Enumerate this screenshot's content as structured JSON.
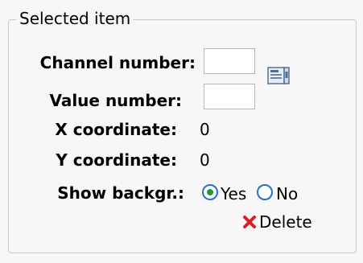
{
  "panel": {
    "legend": "Selected item"
  },
  "form": {
    "channel_label": "Channel number:",
    "channel_value": "",
    "value_label": "Value number:",
    "value_value": "",
    "x_label": "X coordinate:",
    "x_value": "0",
    "y_label": "Y coordinate:",
    "y_value": "0",
    "background_label": "Show backgr.:",
    "background_options": [
      "Yes",
      "No"
    ],
    "background_selected": "Yes"
  },
  "actions": {
    "delete_label": "Delete"
  },
  "icons": {
    "picker": "channel-picker-icon",
    "delete": "delete-x-icon",
    "accent": "#2a6bd6",
    "delete_color": "#e02020"
  }
}
